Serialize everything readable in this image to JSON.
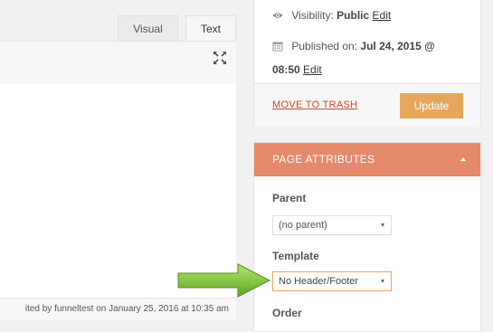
{
  "editor": {
    "tabs": [
      {
        "label": "Visual"
      },
      {
        "label": "Text"
      }
    ],
    "status_text": "ited by funneltest on January 25, 2016 at 10:35 am"
  },
  "publish": {
    "visibility_label": "Visibility:",
    "visibility_value": "Public",
    "visibility_edit": "Edit",
    "published_label": "Published on:",
    "published_value": "Jul 24, 2015 @",
    "published_time": "08:50",
    "published_edit": "Edit",
    "trash_label": "MOVE TO TRASH",
    "update_label": "Update"
  },
  "page_attributes": {
    "title": "PAGE ATTRIBUTES",
    "parent_label": "Parent",
    "parent_value": "(no parent)",
    "template_label": "Template",
    "template_value": "No Header/Footer",
    "order_label": "Order"
  },
  "colors": {
    "accent_header": "#e48a6b",
    "update_button": "#e7a75b",
    "trash_link": "#d1452c",
    "annotation_arrow": "#7dc242"
  },
  "icons": [
    "eye-icon",
    "calendar-icon",
    "fullscreen-icon",
    "chevron-up-icon",
    "chevron-down-icon",
    "green-arrow-annotation"
  ]
}
